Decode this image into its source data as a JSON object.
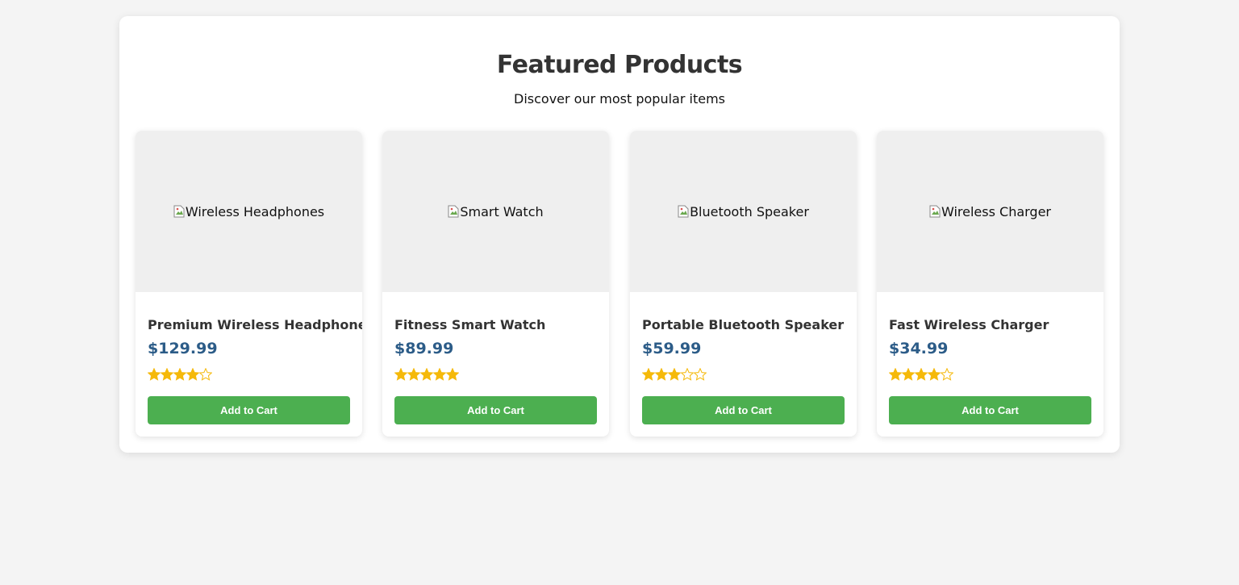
{
  "header": {
    "title": "Featured Products",
    "subtitle": "Discover our most popular items"
  },
  "colors": {
    "page_bg": "#f4f4f4",
    "price": "#2c5c88",
    "button": "#4caf50",
    "star": "#f5b90a",
    "image_bg": "#efefef"
  },
  "products": [
    {
      "image_alt": "Wireless Headphones",
      "name": "Premium Wireless Headphones",
      "price": "$129.99",
      "rating": 4,
      "rating_max": 5,
      "button_label": "Add to Cart"
    },
    {
      "image_alt": "Smart Watch",
      "name": "Fitness Smart Watch",
      "price": "$89.99",
      "rating": 5,
      "rating_max": 5,
      "button_label": "Add to Cart"
    },
    {
      "image_alt": "Bluetooth Speaker",
      "name": "Portable Bluetooth Speaker",
      "price": "$59.99",
      "rating": 3,
      "rating_max": 5,
      "button_label": "Add to Cart"
    },
    {
      "image_alt": "Wireless Charger",
      "name": "Fast Wireless Charger",
      "price": "$34.99",
      "rating": 4,
      "rating_max": 5,
      "button_label": "Add to Cart"
    }
  ]
}
